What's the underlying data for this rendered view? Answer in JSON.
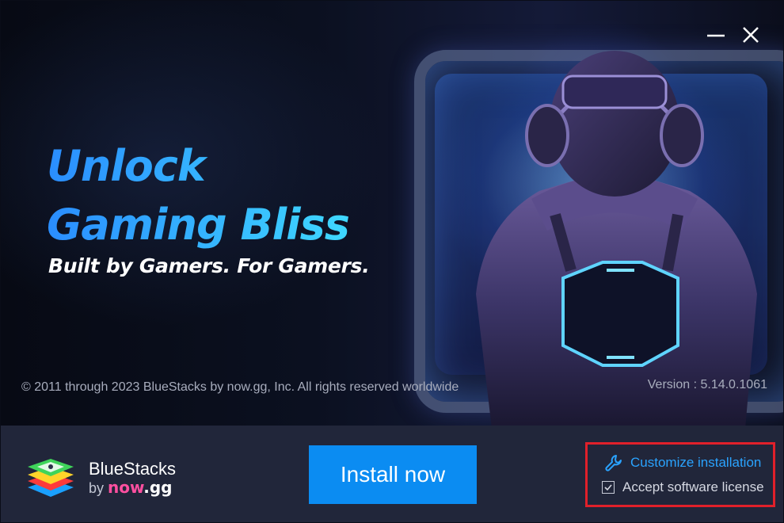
{
  "hero": {
    "headline_line1": "Unlock",
    "headline_line2": "Gaming Bliss",
    "tagline": "Built by Gamers. For Gamers.",
    "copyright": "© 2011 through 2023 BlueStacks by now.gg, Inc. All rights reserved worldwide",
    "version": "Version : 5.14.0.1061"
  },
  "window_controls": {
    "minimize_icon": "minimize-icon",
    "close_icon": "close-icon"
  },
  "footer": {
    "brand_name": "BlueStacks",
    "brand_by": "by",
    "brand_now": "now",
    "brand_gg": ".gg",
    "install_button": "Install now",
    "customize_label": "Customize installation",
    "customize_icon": "wrench-icon",
    "accept_label": "Accept software license",
    "accept_checked": true
  },
  "colors": {
    "accent_blue": "#0b8cf2",
    "link_blue": "#2aa3ff",
    "highlight_red": "#e0202a",
    "footer_bg": "#21263a",
    "brand_pink": "#ff4fa0"
  }
}
